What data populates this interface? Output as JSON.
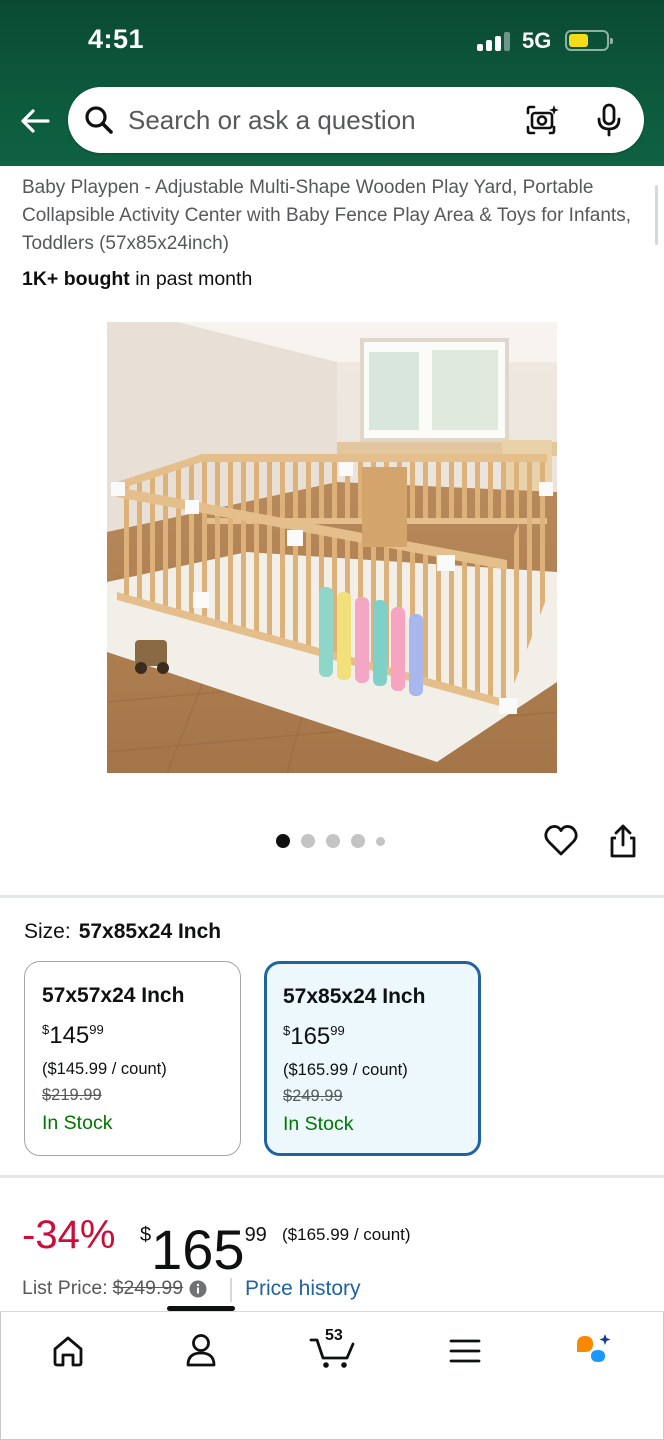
{
  "status_bar": {
    "time": "4:51",
    "network": "5G"
  },
  "search": {
    "placeholder": "Search or ask a question"
  },
  "product": {
    "title": "Baby Playpen - Adjustable Multi-Shape Wooden Play Yard, Portable Collapsible Activity Center with Baby Fence Play Area & Toys for Infants, Toddlers (57x85x24inch)",
    "bought_bold": "1K+ bought",
    "bought_rest": "in past month"
  },
  "carousel": {
    "active_index": 0,
    "dot_count": 5
  },
  "size": {
    "label": "Size:",
    "selected": "57x85x24 Inch",
    "options": [
      {
        "name": "57x57x24 Inch",
        "price_dollar": "$",
        "price_whole": "145",
        "price_cents": "99",
        "per_count": "($145.99 / count)",
        "was": "$219.99",
        "stock": "In Stock",
        "selected": false
      },
      {
        "name": "57x85x24 Inch",
        "price_dollar": "$",
        "price_whole": "165",
        "price_cents": "99",
        "per_count": "($165.99 / count)",
        "was": "$249.99",
        "stock": "In Stock",
        "selected": true
      }
    ]
  },
  "price": {
    "discount": "-34%",
    "currency": "$",
    "whole": "165",
    "cents": "99",
    "per_count": "($165.99 / count)",
    "list_label": "List Price:",
    "list_value": "$249.99",
    "history_link": "Price history"
  },
  "bottom_nav": {
    "items": [
      "home-icon",
      "account-icon",
      "cart-icon",
      "menu-icon",
      "rufus-icon"
    ],
    "cart_count": "53"
  },
  "colors": {
    "header": "#0d5a3d",
    "deal_red": "#cc0c39",
    "link_blue": "#2162a1",
    "stock_green": "#007600",
    "selected_border": "#2162a1"
  }
}
